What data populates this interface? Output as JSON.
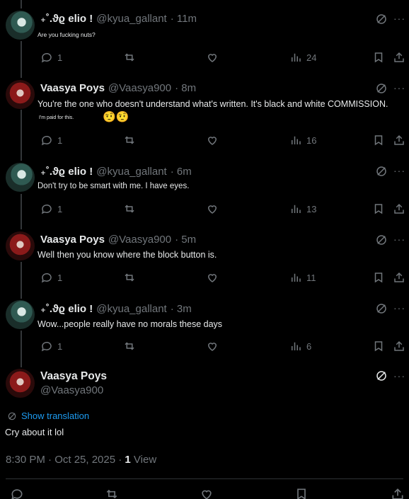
{
  "tweets": [
    {
      "name": "₊˚.ϑϱ elio !",
      "handle": "@kyua_gallant",
      "time": "· 11m",
      "text": "Are you fucking nuts?",
      "replies": "1",
      "views": "24"
    },
    {
      "name": "Vaasya Poys",
      "handle": "@Vaasya900",
      "time": "· 8m",
      "text": "You're the one who doesn't understand what's written. It's black and white COMMISSION.",
      "small": "I'm paid for this.",
      "emoji": "🤨🤨",
      "replies": "1",
      "views": "16"
    },
    {
      "name": "₊˚.ϑϱ elio !",
      "handle": "@kyua_gallant",
      "time": "· 6m",
      "text": "Don't try to be smart with me. I have eyes.",
      "replies": "1",
      "views": "13"
    },
    {
      "name": "Vaasya Poys",
      "handle": "@Vaasya900",
      "time": "· 5m",
      "text": "Well then you know where the block button is.",
      "replies": "1",
      "views": "11"
    },
    {
      "name": "₊˚.ϑϱ elio !",
      "handle": "@kyua_gallant",
      "time": "· 3m",
      "text": "Wow...people really have no morals these days",
      "replies": "1",
      "views": "6"
    }
  ],
  "main": {
    "name": "Vaasya Poys",
    "handle": "@Vaasya900",
    "translate_label": "Show translation",
    "text": "Cry about it lol",
    "timestamp": "8:30 PM · Oct 25, 2025 · ",
    "views_count": "1",
    "views_label": " View"
  },
  "icons": {
    "reply": "reply-icon",
    "repost": "repost-icon",
    "like": "heart-icon",
    "views": "views-icon",
    "bookmark": "bookmark-icon",
    "share": "share-icon",
    "grok": "grok-icon",
    "more": "more-icon"
  },
  "colors": {
    "background": "#000000",
    "text": "#e7e9ea",
    "muted": "#71767b",
    "link": "#1d9bf0"
  }
}
